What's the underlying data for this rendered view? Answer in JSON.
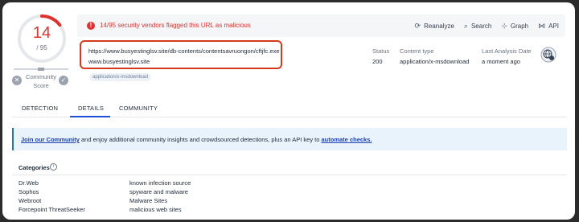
{
  "score": {
    "detections": "14",
    "total": "/ 95",
    "fraction": 0.147,
    "community_label_line1": "Community",
    "community_label_line2": "Score"
  },
  "alert": {
    "icon": "alert-circle-icon",
    "text": "14/95 security vendors flagged this URL as malicious",
    "color": "#e03131"
  },
  "actions": [
    {
      "label": "Reanalyze",
      "icon": "refresh-icon"
    },
    {
      "label": "Search",
      "icon": "search-icon"
    },
    {
      "label": "Graph",
      "icon": "graph-icon"
    },
    {
      "label": "API",
      "icon": "api-icon"
    }
  ],
  "url": {
    "full": "https://www.busyestinglsv.site/db-contents/contentsavruongon/cftjfc.exe",
    "domain": "www.busyestinglsv.site",
    "tag": "application/x-msdownload"
  },
  "meta": {
    "status_label": "Status",
    "status_value": "200",
    "content_type_label": "Content type",
    "content_type_value": "application/x-msdownload",
    "date_label": "Last Analysis Date",
    "date_value": "a moment ago"
  },
  "tabs": [
    {
      "label": "DETECTION"
    },
    {
      "label": "DETAILS"
    },
    {
      "label": "COMMUNITY"
    }
  ],
  "banner": {
    "link1": "Join our Community",
    "middle": " and enjoy additional community insights and crowdsourced detections, plus an API key to ",
    "link2": "automate checks."
  },
  "categories": {
    "title": "Categories",
    "rows": [
      {
        "vendor": "Dr.Web",
        "value": "known infection source"
      },
      {
        "vendor": "Sophos",
        "value": "spyware and malware"
      },
      {
        "vendor": "Webroot",
        "value": "Malware Sites"
      },
      {
        "vendor": "Forcepoint ThreatSeeker",
        "value": "malicious web sites"
      }
    ]
  }
}
